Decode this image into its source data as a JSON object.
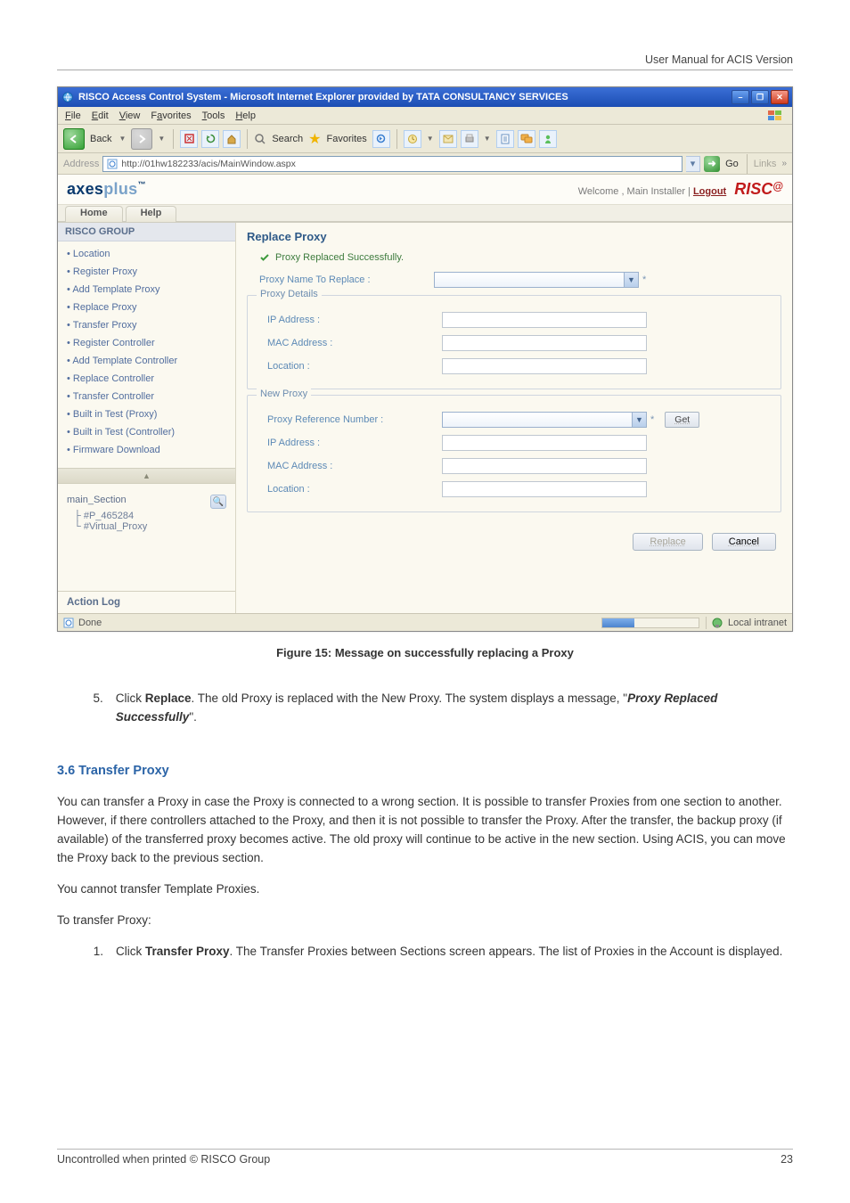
{
  "doc_header": "User Manual for ACIS Version",
  "figure_caption": "Figure 15: Message on successfully replacing a Proxy",
  "step5": {
    "num": "5.",
    "text_prefix": "Click ",
    "btn": "Replace",
    "text_mid": ". The old Proxy is replaced with the New Proxy. The system displays a message, \"",
    "msg": "Proxy Replaced Successfully",
    "text_suffix": "\"."
  },
  "section_heading": "3.6  Transfer Proxy",
  "section_para1": "You can transfer a Proxy in case the Proxy is connected to a wrong section. It is possible to transfer Proxies from one section to another. However, if there controllers attached to the Proxy, and then it is not possible to transfer the Proxy. After the transfer, the backup proxy (if available) of the transferred proxy becomes active. The old proxy will continue to be active in the new section. Using ACIS, you can move the Proxy back to the previous section.",
  "section_para2": "You cannot transfer Template Proxies.",
  "section_para3": "To transfer Proxy:",
  "step1b": {
    "num": "1.",
    "text_prefix": "Click ",
    "btn": "Transfer Proxy",
    "text_suffix": ". The Transfer Proxies between Sections screen appears. The list of Proxies in the Account is displayed."
  },
  "footer_left": "Uncontrolled when printed © RISCO Group",
  "footer_right": "23",
  "win_title": "RISCO Access Control System - Microsoft Internet Explorer provided by TATA CONSULTANCY SERVICES",
  "menus": {
    "file": "File",
    "edit": "Edit",
    "view": "View",
    "favorites": "Favorites",
    "tools": "Tools",
    "help": "Help"
  },
  "toolbar": {
    "back_label": "Back",
    "search_label": "Search",
    "favorites_label": "Favorites"
  },
  "address": {
    "label": "Address",
    "url": "http://01hw182233/acis/MainWindow.aspx",
    "go": "Go",
    "links": "Links"
  },
  "appbar": {
    "brand_axes": "axes",
    "brand_plus": "plus",
    "welcome": "Welcome ,  Main Installer  |",
    "logout": "Logout",
    "risco": "RISC"
  },
  "tabs": {
    "home": "Home",
    "help": "Help"
  },
  "sidebar": {
    "title": "RISCO GROUP",
    "items": [
      "Location",
      "Register Proxy",
      "Add Template Proxy",
      "Replace Proxy",
      "Transfer Proxy",
      "Register Controller",
      "Add Template Controller",
      "Replace Controller",
      "Transfer Controller",
      "Built in Test (Proxy)",
      "Built in Test (Controller)",
      "Firmware Download"
    ],
    "tree_root": "main_Section",
    "tree_children": [
      "#P_465284",
      "#Virtual_Proxy"
    ],
    "action_log": "Action Log"
  },
  "main": {
    "title": "Replace Proxy",
    "success_msg": "Proxy Replaced Successfully.",
    "replace_label": "Proxy Name To Replace :",
    "box1_legend": "Proxy Details",
    "ip_label": "IP Address :",
    "mac_label": "MAC Address :",
    "loc_label": "Location :",
    "box2_legend": "New Proxy",
    "ref_label": "Proxy Reference Number :",
    "get_btn": "Get",
    "buttons": {
      "replace": "Replace",
      "cancel": "Cancel"
    }
  },
  "status": {
    "done": "Done",
    "zone": "Local intranet"
  }
}
